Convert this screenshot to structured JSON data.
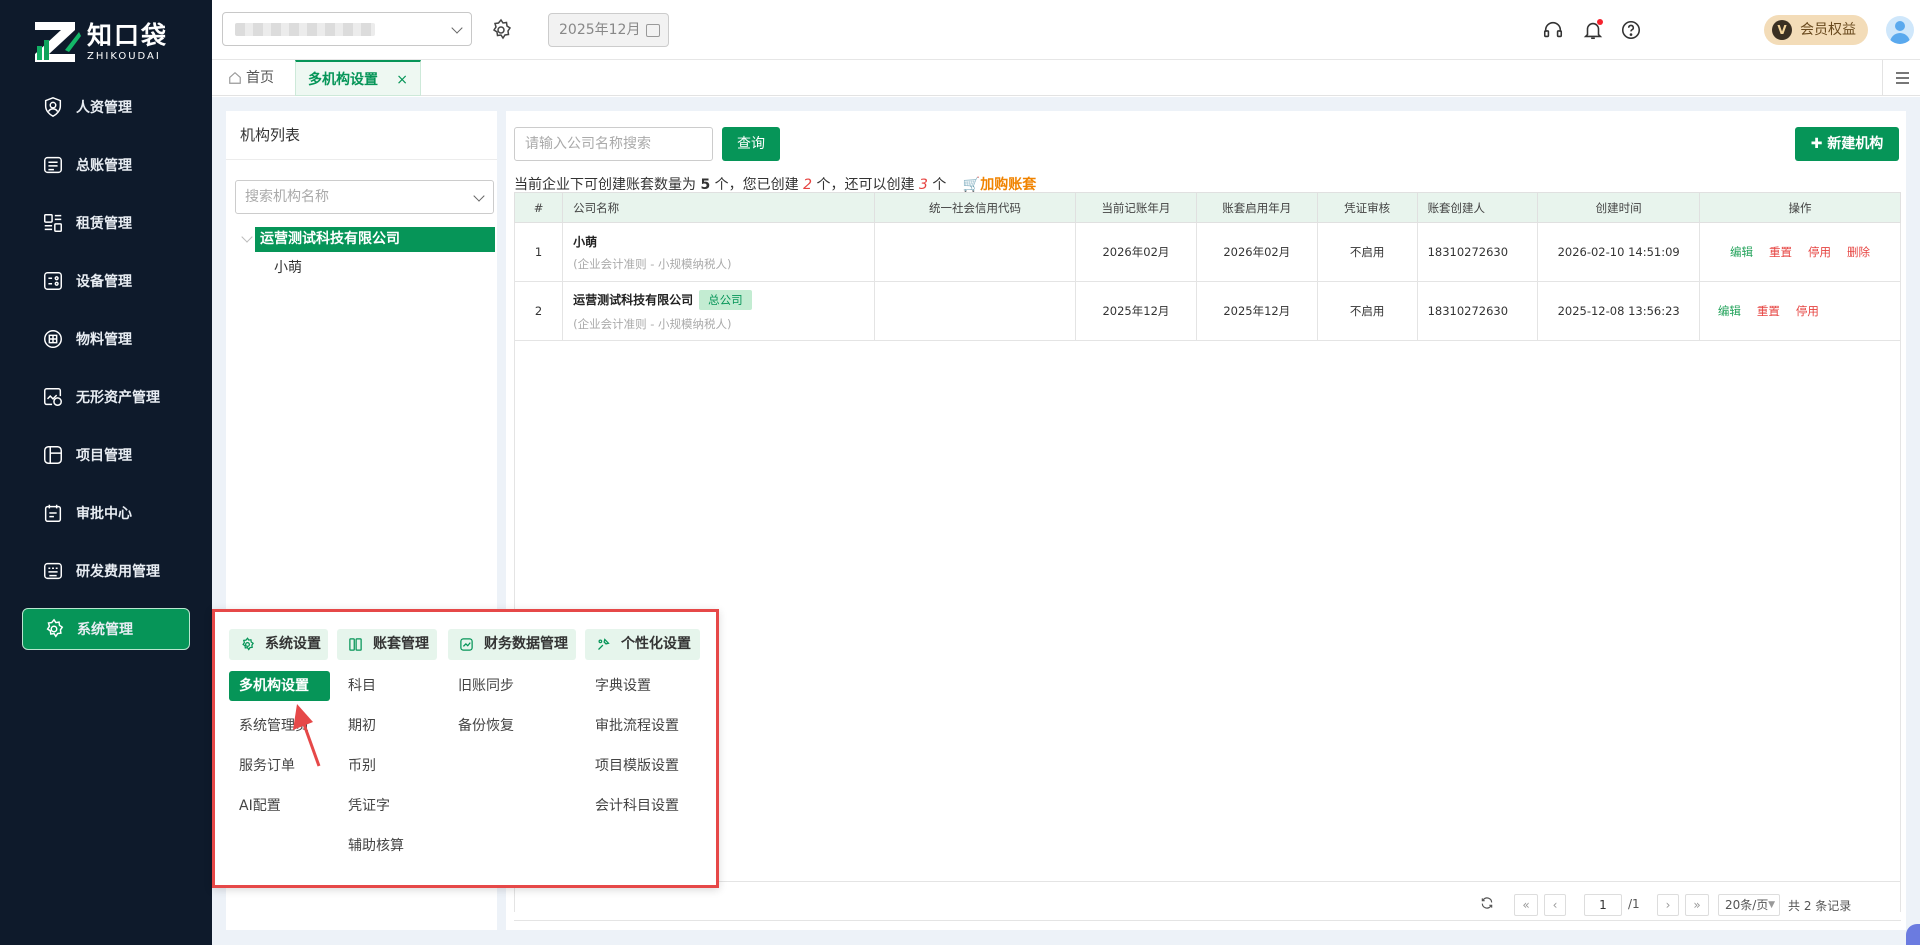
{
  "brand": {
    "name_cn": "知口袋",
    "name_en": "ZHIKOUDAI",
    "accent": "#069558"
  },
  "sidebar": {
    "items": [
      {
        "label": "人资管理",
        "icon": "person-shield-icon"
      },
      {
        "label": "总账管理",
        "icon": "ledger-icon"
      },
      {
        "label": "租赁管理",
        "icon": "lease-doc-icon"
      },
      {
        "label": "设备管理",
        "icon": "device-icon"
      },
      {
        "label": "物料管理",
        "icon": "material-box-icon"
      },
      {
        "label": "无形资产管理",
        "icon": "intangible-asset-icon"
      },
      {
        "label": "项目管理",
        "icon": "project-icon"
      },
      {
        "label": "审批中心",
        "icon": "approval-icon"
      },
      {
        "label": "研发费用管理",
        "icon": "rnd-keyboard-icon"
      },
      {
        "label": "系统管理",
        "icon": "gear-icon",
        "active": true
      }
    ]
  },
  "header": {
    "period": "2025年12月",
    "member_label": "会员权益",
    "member_badge": "V"
  },
  "tabs": {
    "home": "首页",
    "current": "多机构设置",
    "close": "×"
  },
  "org_panel": {
    "title": "机构列表",
    "search_placeholder": "搜索机构名称",
    "root": "运营测试科技有限公司",
    "child": "小萌"
  },
  "main": {
    "search_placeholder": "请输入公司名称搜索",
    "query_button": "查询",
    "new_button": "新建机构",
    "notice": {
      "prefix": "当前企业下可创建账套数量为",
      "max": "5",
      "mid1": "个，您已创建",
      "created": "2",
      "mid2": "个，还可以创建",
      "remaining": "3",
      "suffix": "个",
      "buy": "加购账套"
    },
    "table": {
      "columns": [
        "#",
        "公司名称",
        "统一社会信用代码",
        "当前记账年月",
        "账套启用年月",
        "凭证审核",
        "账套创建人",
        "创建时间",
        "操作"
      ],
      "rows": [
        {
          "no": "1",
          "name": "小萌",
          "sub": "(企业会计准则 - 小规模纳税人)",
          "badge": "",
          "credit": "",
          "cur": "2026年02月",
          "start": "2026年02月",
          "audit": "不启用",
          "creator": "18310272630",
          "created": "2026-02-10 14:51:09",
          "ops": [
            "编辑",
            "重置",
            "停用",
            "删除"
          ]
        },
        {
          "no": "2",
          "name": "运营测试科技有限公司",
          "sub": "(企业会计准则 - 小规模纳税人)",
          "badge": "总公司",
          "credit": "",
          "cur": "2025年12月",
          "start": "2025年12月",
          "audit": "不启用",
          "creator": "18310272630",
          "created": "2025-12-08 13:56:23",
          "ops": [
            "编辑",
            "重置",
            "停用"
          ]
        }
      ]
    },
    "pager": {
      "page": "1",
      "total_pages": "/1",
      "page_size": "20条/页",
      "total": "共 2 条记录"
    }
  },
  "popup_menu": {
    "sections": [
      {
        "title": "系统设置",
        "icon": "gear-icon",
        "items": [
          "多机构设置",
          "系统管理员",
          "服务订单",
          "AI配置"
        ]
      },
      {
        "title": "账套管理",
        "icon": "books-icon",
        "items": [
          "科目",
          "期初",
          "币别",
          "凭证字",
          "辅助核算"
        ]
      },
      {
        "title": "财务数据管理",
        "icon": "data-chart-icon",
        "items": [
          "旧账同步",
          "备份恢复"
        ]
      },
      {
        "title": "个性化设置",
        "icon": "customize-icon",
        "items": [
          "字典设置",
          "审批流程设置",
          "项目模版设置",
          "会计科目设置"
        ]
      }
    ]
  }
}
